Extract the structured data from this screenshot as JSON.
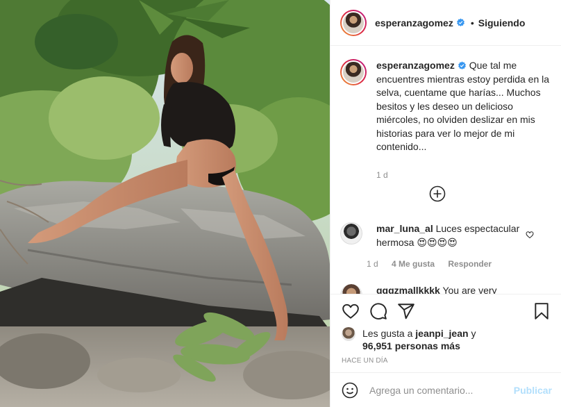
{
  "post": {
    "author": {
      "username": "esperanzagomez",
      "verified": true
    },
    "header": {
      "separator": "•",
      "follow_status": "Siguiendo"
    },
    "caption": {
      "username": "esperanzagomez",
      "text": "Que tal me encuentres mientras estoy perdida en la selva, cuentame que harías... Muchos besitos y les deseo un delicioso miércoles, no olviden deslizar en mis historias para ver lo mejor de mi contenido...",
      "time": "1 d"
    },
    "load_more_icon": "plus-circle-icon",
    "comments": [
      {
        "username": "mar_luna_al",
        "text": "Luces espectacular hermosa 😍😍😍😍",
        "time": "1 d",
        "likes": "4 Me gusta",
        "reply": "Responder"
      },
      {
        "username": "gggzmallkkkk",
        "text": "You are very"
      }
    ],
    "actions": {
      "icons": [
        "heart-icon",
        "comment-icon",
        "share-icon",
        "bookmark-icon"
      ]
    },
    "likes": {
      "prefix": "Les gusta a",
      "liker": "jeanpi_jean",
      "connector": "y",
      "count_text": "96,951 personas más"
    },
    "posted": "Hace un día",
    "composer": {
      "placeholder": "Agrega un comentario...",
      "publish_label": "Publicar",
      "emoji_icon": "smiley-icon"
    }
  },
  "colors": {
    "text": "#262626",
    "secondary": "#8e8e8e",
    "verified_blue": "#3897f0",
    "publish_disabled": "#b2dffc",
    "border": "#efefef"
  }
}
